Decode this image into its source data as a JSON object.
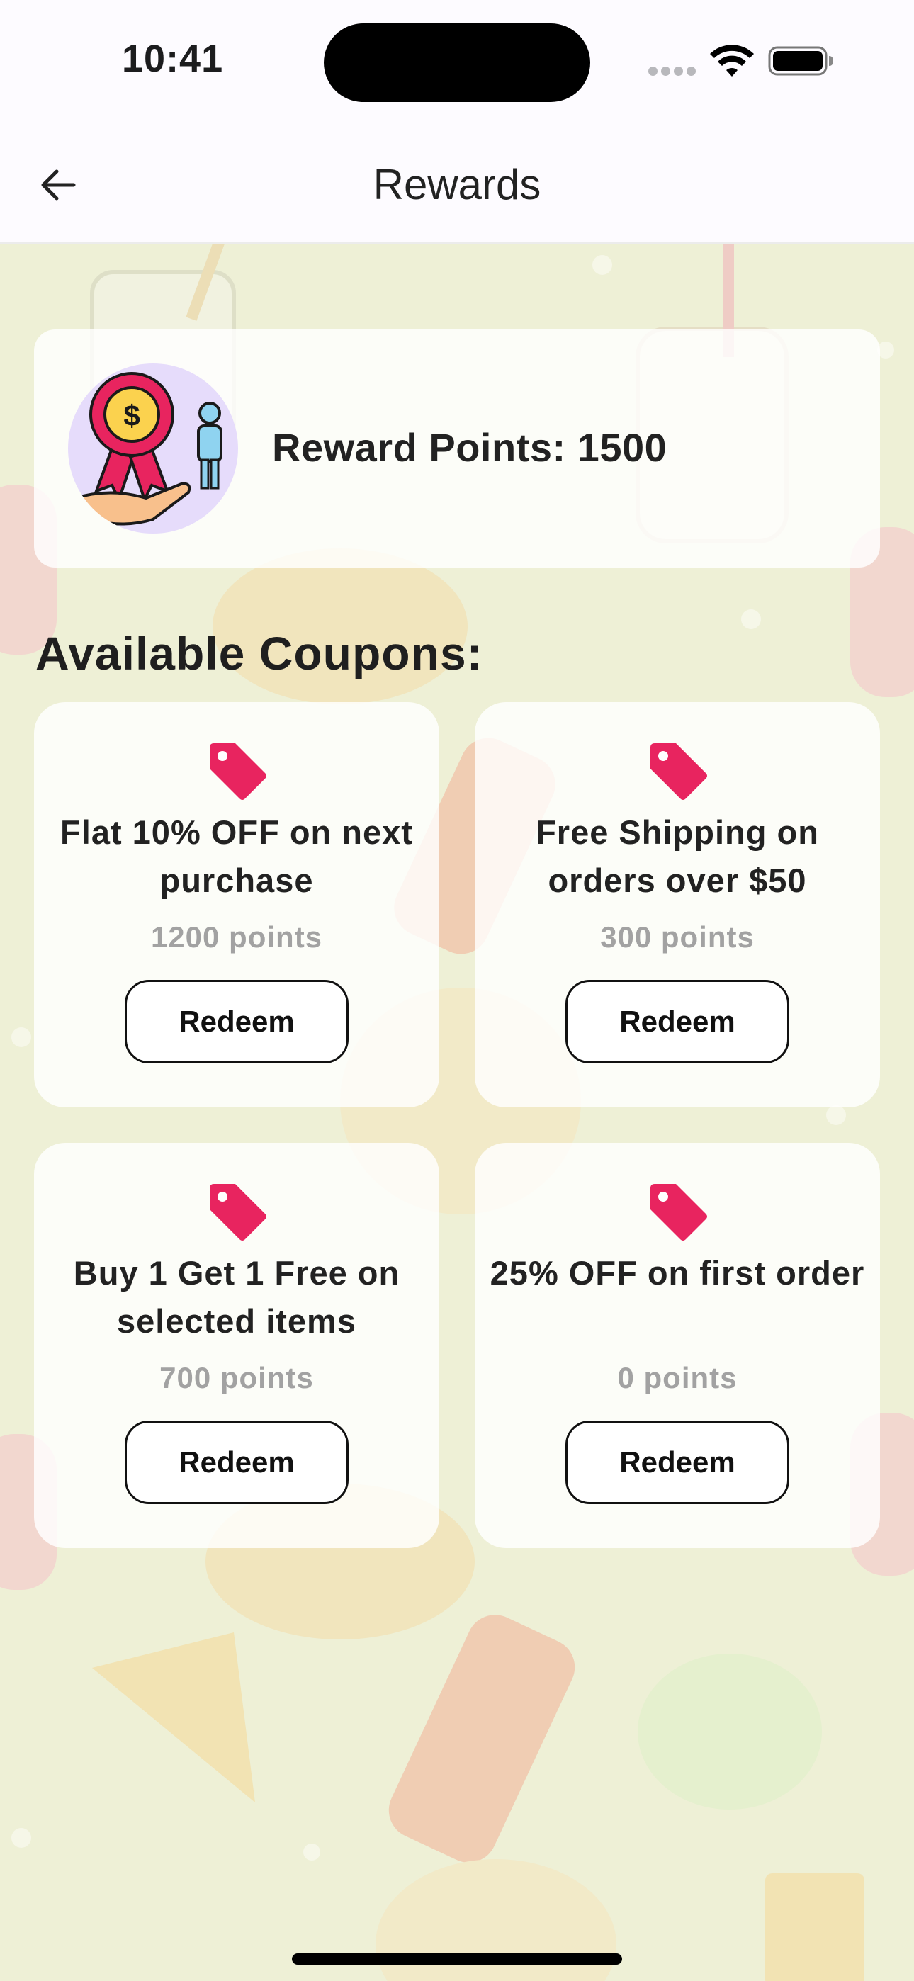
{
  "status_bar": {
    "time": "10:41"
  },
  "nav": {
    "title": "Rewards",
    "back_icon": "arrow-left-icon"
  },
  "reward": {
    "label": "Reward Points: 1500",
    "icon": "reward-badge-icon"
  },
  "coupons_section": {
    "title": "Available Coupons:"
  },
  "coupons": [
    {
      "title": "Flat 10% OFF on next purchase",
      "points": "1200 points",
      "button": "Redeem",
      "icon": "tag-icon"
    },
    {
      "title": "Free Shipping on orders over $50",
      "points": "300 points",
      "button": "Redeem",
      "icon": "tag-icon"
    },
    {
      "title": "Buy 1 Get 1 Free on selected items",
      "points": "700 points",
      "button": "Redeem",
      "icon": "tag-icon"
    },
    {
      "title": "25% OFF on first order",
      "points": "0 points",
      "button": "Redeem",
      "icon": "tag-icon"
    }
  ],
  "colors": {
    "tag": "#e8245f",
    "background": "#eef0d6",
    "card": "#ffffff"
  }
}
